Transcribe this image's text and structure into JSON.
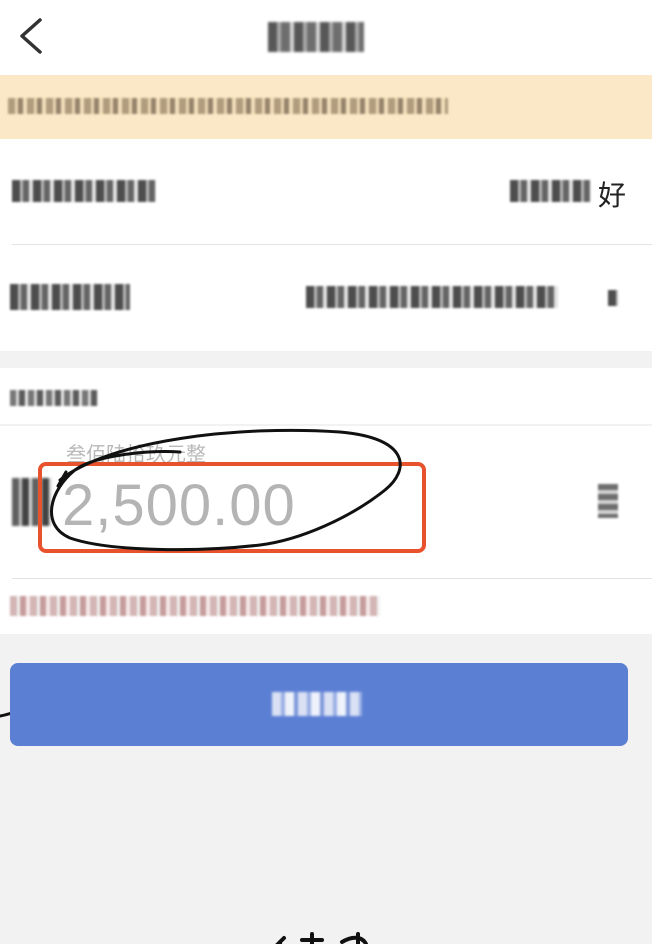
{
  "header": {
    "back_icon": "chevron-left-icon",
    "title": ""
  },
  "notice": {
    "text": ""
  },
  "payee": {
    "label": "",
    "value_visible_suffix": "好"
  },
  "account": {
    "label": "",
    "value": ""
  },
  "amount_section": {
    "label": "",
    "amount_in_words": "叁佰陆拾玖元整",
    "currency_symbol": "¥",
    "amount": "2,500.00",
    "chevron_icon": "chevron-right-icon"
  },
  "hint": {
    "text": ""
  },
  "next_button": {
    "label": ""
  },
  "colors": {
    "notice_bg": "#fbe8c6",
    "button_bg": "#5b7fd3",
    "annotation_red": "#e8532e",
    "page_bg": "#f2f2f2"
  }
}
